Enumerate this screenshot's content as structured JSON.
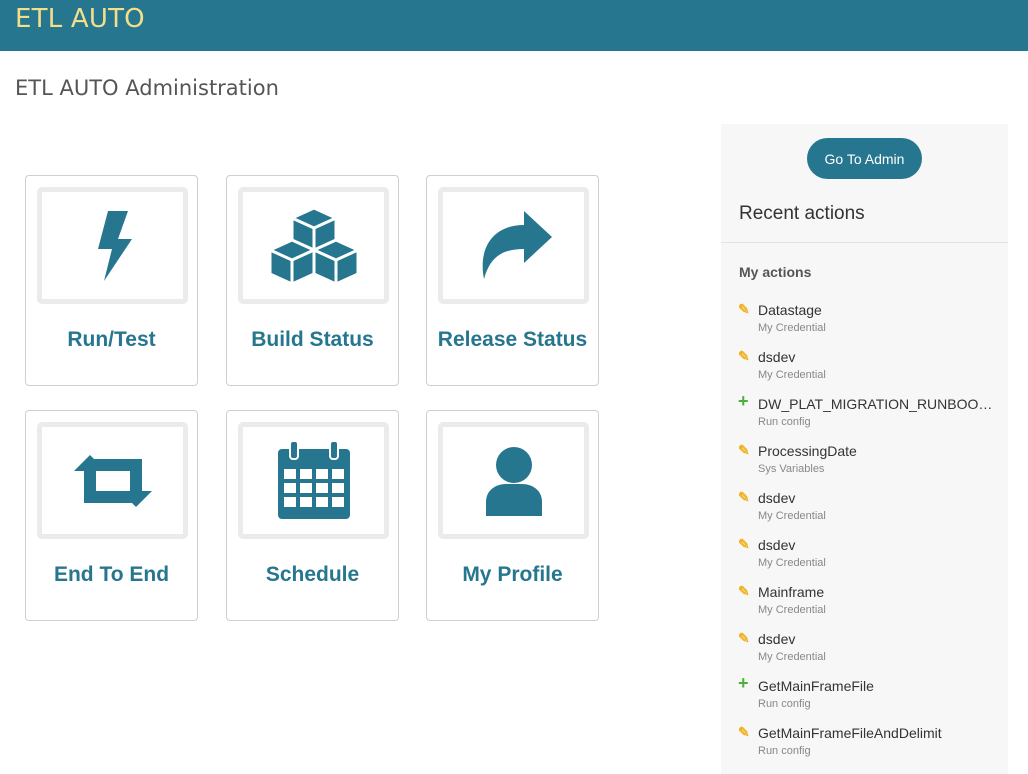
{
  "header": {
    "brand": "ETL AUTO"
  },
  "page": {
    "title": "ETL AUTO Administration"
  },
  "tiles": [
    {
      "label": "Run/Test",
      "icon": "bolt-icon"
    },
    {
      "label": "Build Status",
      "icon": "cubes-icon"
    },
    {
      "label": "Release Status",
      "icon": "share-arrow-icon"
    },
    {
      "label": "End To End",
      "icon": "retweet-icon"
    },
    {
      "label": "Schedule",
      "icon": "calendar-icon"
    },
    {
      "label": "My Profile",
      "icon": "user-icon"
    }
  ],
  "sidebar": {
    "admin_button": "Go To Admin",
    "recent_title": "Recent actions",
    "my_actions_label": "My actions",
    "actions": [
      {
        "type": "edit",
        "name": "Datastage",
        "sub": "My Credential"
      },
      {
        "type": "edit",
        "name": "dsdev",
        "sub": "My Credential"
      },
      {
        "type": "add",
        "name": "DW_PLAT_MIGRATION_RUNBOOK...",
        "sub": "Run config"
      },
      {
        "type": "edit",
        "name": "ProcessingDate",
        "sub": "Sys Variables"
      },
      {
        "type": "edit",
        "name": "dsdev",
        "sub": "My Credential"
      },
      {
        "type": "edit",
        "name": "dsdev",
        "sub": "My Credential"
      },
      {
        "type": "edit",
        "name": "Mainframe",
        "sub": "My Credential"
      },
      {
        "type": "edit",
        "name": "dsdev",
        "sub": "My Credential"
      },
      {
        "type": "add",
        "name": "GetMainFrameFile",
        "sub": "Run config"
      },
      {
        "type": "edit",
        "name": "GetMainFrameFileAndDelimit",
        "sub": "Run config"
      }
    ]
  },
  "colors": {
    "brand_bar": "#27768f",
    "brand_text": "#f3de8a",
    "accent": "#27768f",
    "edit_icon": "#f0b323",
    "add_icon": "#4caf37"
  }
}
